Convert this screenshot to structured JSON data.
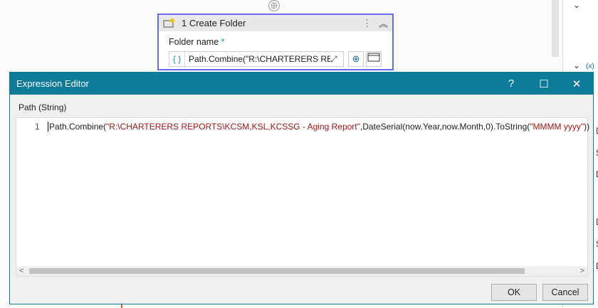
{
  "workflow": {
    "add_icon": "plus-circle-icon",
    "card": {
      "index_title": "1 Create Folder",
      "field_label": "Folder name",
      "required_mark": "*",
      "field_value": "Path.Combine(\"R:\\CHARTERERS REP(...",
      "brace": "{ }",
      "expand": "⤢",
      "add": "⊕",
      "more": "⋮",
      "collapse": "︽"
    }
  },
  "right_panel": {
    "items": [
      "D",
      "S",
      "D",
      "D",
      "S",
      "D"
    ],
    "var_icon": "(x)"
  },
  "dialog": {
    "title": "Expression Editor",
    "help": "?",
    "maximize": "☐",
    "close": "✕",
    "label": "Path (String)",
    "line_number": "1",
    "code": {
      "p1": "Path.Combine(",
      "s1": "\"R:\\CHARTERERS REPORTS\\KCSM,KSL,KCSSG - Aging Report\"",
      "p2": ",DateSerial(now.Year,now.Month,0).ToString(",
      "s2": "\"MMMM yyyy\"",
      "p3": "))"
    },
    "ok": "OK",
    "cancel": "Cancel"
  },
  "colors": {
    "titlebar": "#0e7c99",
    "card_border": "#6a6af2",
    "string": "#a31515"
  }
}
